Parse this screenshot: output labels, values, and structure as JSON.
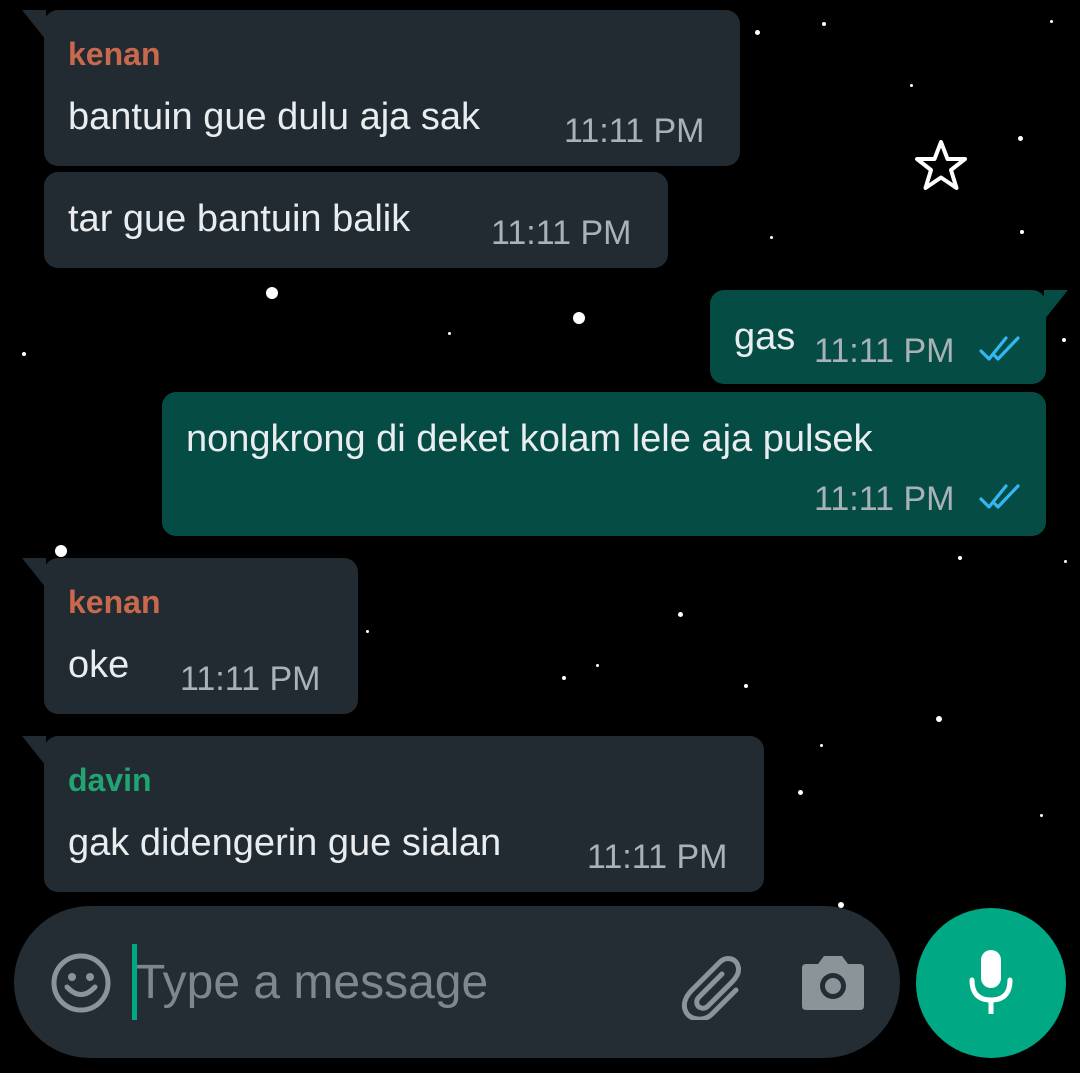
{
  "colors": {
    "incoming_bubble": "#222b31",
    "outgoing_bubble": "#054d44",
    "sender_kenan": "#c8694e",
    "sender_davin": "#20a472",
    "read_ticks": "#34b7f1",
    "accent": "#00a884"
  },
  "messages": [
    {
      "direction": "incoming",
      "sender": "kenan",
      "text": "bantuin gue dulu aja sak",
      "time": "11:11 PM"
    },
    {
      "direction": "incoming",
      "sender": "",
      "text": "tar gue bantuin balik",
      "time": "11:11 PM"
    },
    {
      "direction": "outgoing",
      "text": "gas",
      "time": "11:11 PM",
      "status": "read"
    },
    {
      "direction": "outgoing",
      "text": "nongkrong di deket kolam lele aja pulsek",
      "time": "11:11 PM",
      "status": "read"
    },
    {
      "direction": "incoming",
      "sender": "kenan",
      "text": "oke",
      "time": "11:11 PM"
    },
    {
      "direction": "incoming",
      "sender": "davin",
      "text": "gak didengerin gue sialan",
      "time": "11:11 PM"
    }
  ],
  "composer": {
    "placeholder": "Type a message",
    "value": "",
    "icons": [
      "emoji-icon",
      "paperclip-icon",
      "camera-icon"
    ],
    "send_icon": "microphone-icon"
  }
}
